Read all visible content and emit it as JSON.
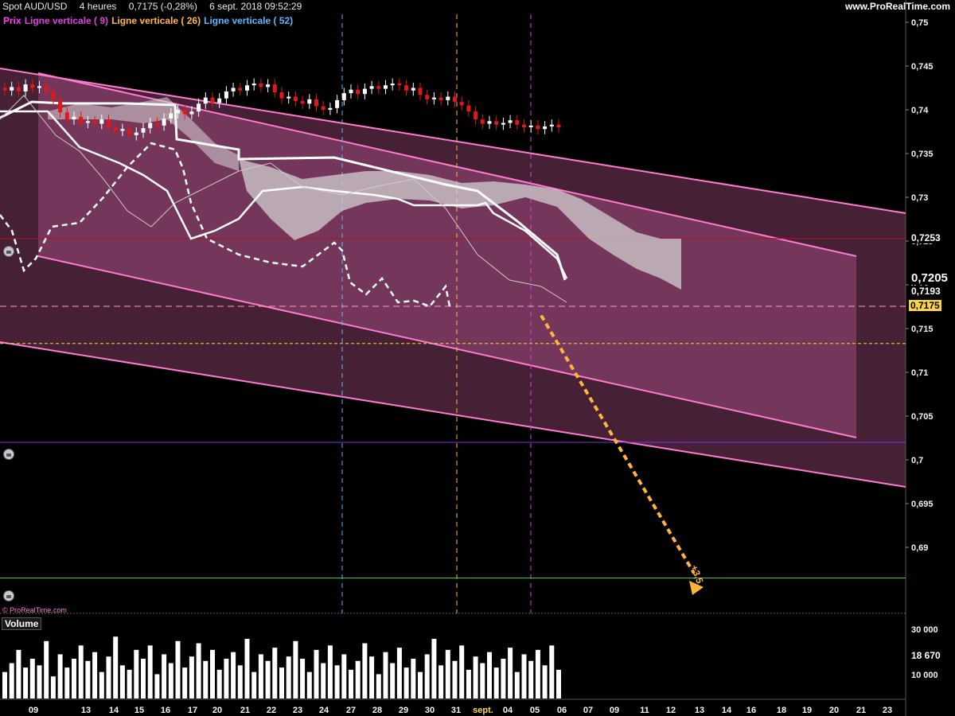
{
  "header": {
    "instrument": "Spot AUD/USD",
    "timeframe": "4 heures",
    "quote": "0,7175 (-0,28%)",
    "datetime": "6 sept. 2018 09:52:29",
    "site": "www.ProRealTime.com"
  },
  "legend": {
    "items": [
      {
        "label": "Prix",
        "color": "#ff40ff"
      },
      {
        "label": "Ligne verticale ( 9)",
        "color": "#e040e0"
      },
      {
        "label": "Ligne verticale ( 26)",
        "color": "#ffb84a"
      },
      {
        "label": "Ligne verticale ( 52)",
        "color": "#5ab8ff"
      }
    ]
  },
  "badges": {
    "level_1": "0,7253",
    "level_2": "0,7205",
    "level_3": "0,7193",
    "current": "0,7175"
  },
  "annotation": {
    "arrow_label": "+3,5"
  },
  "credit": "© ProRealTime.com",
  "volume": {
    "title": "Volume",
    "current": "18 670",
    "ticks": [
      "30 000",
      "10 000"
    ]
  },
  "colors": {
    "background": "#000000",
    "channel_outer": "#ff7ad1",
    "channel_fill": "#9b4978",
    "cloud": "#d8d8d8",
    "candle_up": "#ffffff",
    "candle_down": "#e01818",
    "projection": "#ffb43a",
    "resistance": "#b01020",
    "support_purple": "#8a2be2",
    "support_green": "#34d03a",
    "current_badge_bg": "#ffd43a"
  },
  "chart_data": [
    {
      "type": "candlestick",
      "title": "Spot AUD/USD",
      "interval": "4 heures",
      "ylim": [
        0.684,
        0.752
      ],
      "y_ticks": [
        "0,75",
        "0,745",
        "0,74",
        "0,735",
        "0,73",
        "0,725",
        "0,72",
        "0,715",
        "0,71",
        "0,705",
        "0,7",
        "0,695",
        "0,69"
      ],
      "x_tick_labels": [
        "09",
        "13",
        "14",
        "15",
        "16",
        "17",
        "20",
        "21",
        "22",
        "23",
        "24",
        "27",
        "28",
        "29",
        "30",
        "31",
        "sept.",
        "04",
        "05",
        "06",
        "07",
        "09",
        "11",
        "12",
        "13",
        "14",
        "16",
        "18",
        "19",
        "20",
        "21",
        "23"
      ],
      "last_price": 0.7175,
      "horizontal_levels": [
        {
          "price": 0.7253,
          "color": "#b01020"
        },
        {
          "price": 0.7133,
          "color": "#ffd43a",
          "style": "dashed"
        },
        {
          "price": 0.702,
          "color": "#8a2be2"
        },
        {
          "price": 0.6865,
          "color": "#34d03a"
        }
      ],
      "vertical_markers": [
        {
          "label": "Ligne verticale ( 52)",
          "at": "24-27"
        },
        {
          "label": "Ligne verticale ( 26)",
          "at": "31"
        },
        {
          "label": "Ligne verticale ( 9)",
          "at": "05"
        }
      ],
      "projection": {
        "from": 0.7165,
        "to": 0.6865,
        "label": "+3,5"
      }
    },
    {
      "type": "bar",
      "title": "Volume",
      "current_value": 18670,
      "ylim": [
        0,
        36000
      ],
      "y_ticks": [
        "30 000",
        "10 000"
      ]
    }
  ]
}
